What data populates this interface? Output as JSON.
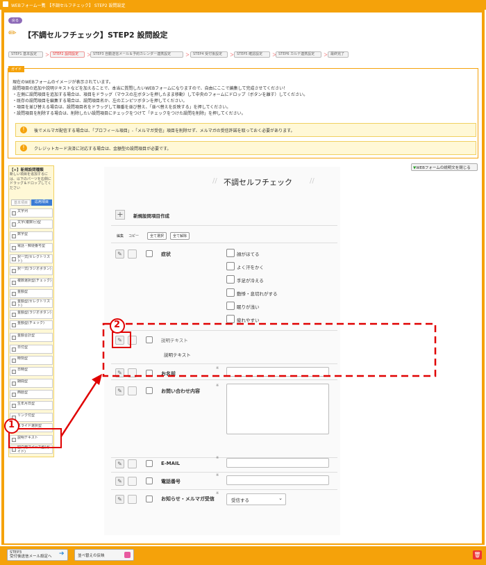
{
  "breadcrumb": {
    "home": "",
    "item1": "WEBフォーム一覧",
    "sep": ">",
    "item2": "【不調セルフチェック】 STEP2 設問設定"
  },
  "badge": "戻る",
  "page_title": "【不調セルフチェック】STEP2 設問設定",
  "steps": [
    "STEP1 基本設定",
    "STEP2 設問設定",
    "STEP3 自動送信メール＆予約カレンダー連携設定",
    "STEP4 受付後設定",
    "STEP5 確認設定",
    "STEP6 カルテ連携設定",
    "最終完了"
  ],
  "guide": {
    "label": "ガイド",
    "lines": [
      "現在のWEBフォームのイメージが表示されています。",
      "設問項目の追加や説明テキストなどを加えることで、本当に質問したいWEBフォームになりますので、自由にここで編集して完成させてください！",
      "・左側に設問項目を追加する場合は、項目をドラッグ（マウスの左ボタンを押したまま移動）して中央のフォームにドロップ（ボタンを離す）してください。",
      "・既存の設問項目を編集する場合は、設問項目名か、左のエンピツボタンを押してください。",
      "・項目を並び替える場合は、設問項目名をドラッグして順番を並び替え、「並べ替えを反映する」を押してください。",
      "・設問項目を削除する場合は、削除したい設問項目にチェックをつけて「チェックをつけた設問を削除」を押してください。"
    ],
    "note1": "後でメルマガ配信する場合は、「プロフィール項目」-「メルマガ受信」項目を削除せず、メルマガの受信許諾を取っておく必要があります。",
    "note2": "クレジットカード決済に対応する場合は、金額型の設問項目が必要です。"
  },
  "collapse_btn": "WEBフォームの説明文を閉じる",
  "left": {
    "title": "【+】新規設問種類",
    "desc": "新しい項目を追加するには、以下のパーツを右側にドラッグ＆ドロップしてください",
    "tab1": "基本項目",
    "tab2": "応用項目",
    "items": [
      "文字列",
      "文字(複数行)型",
      "数字型",
      "電話・郵便番号型",
      "択一式(セレクトリスト)",
      "択一式(ラジオボタン)",
      "複数選択型(チェック)",
      "金額型",
      "金額型(セレクトリスト)",
      "金額型(ラジオボタン)",
      "金額型(チェック)",
      "金額合計型",
      "日付型",
      "時刻型",
      "日時型",
      "期間型",
      "西暦型",
      "生年月日型",
      "リンク付型",
      "スライド選択型",
      "説明テキスト",
      "空白用スペース型(ガイド)"
    ]
  },
  "form": {
    "title": "不調セルフチェック",
    "new_item": "新規設問項目作成",
    "edit": "編集",
    "copy": "コピー",
    "select_all": "全て選択",
    "deselect_all": "全て解除",
    "q1": {
      "label": "症状",
      "options": [
        "顔がほてる",
        "よく汗をかく",
        "手足が冷える",
        "動悸・息切れがする",
        "眠りが浅い",
        "疲れやすい"
      ]
    },
    "desc_item": {
      "label": "説明テキスト",
      "text": "説明テキスト"
    },
    "name": {
      "label": "お名前",
      "req": "※"
    },
    "inquiry": {
      "label": "お問い合わせ内容",
      "req": "※"
    },
    "email": {
      "label": "E-MAIL",
      "req": "※"
    },
    "phone": {
      "label": "電話番号",
      "req": "※"
    },
    "mailmag": {
      "label": "お知らせ・メルマガ受信",
      "req": "※",
      "value": "受信する"
    }
  },
  "annotations": {
    "one": "1",
    "two": "2"
  },
  "bottom": {
    "step3": "STEP3\n受付後送信メール設定へ",
    "apply": "並べ替えの反映"
  },
  "colors": {
    "accent": "#f5a20a",
    "annotation": "#e00000"
  }
}
